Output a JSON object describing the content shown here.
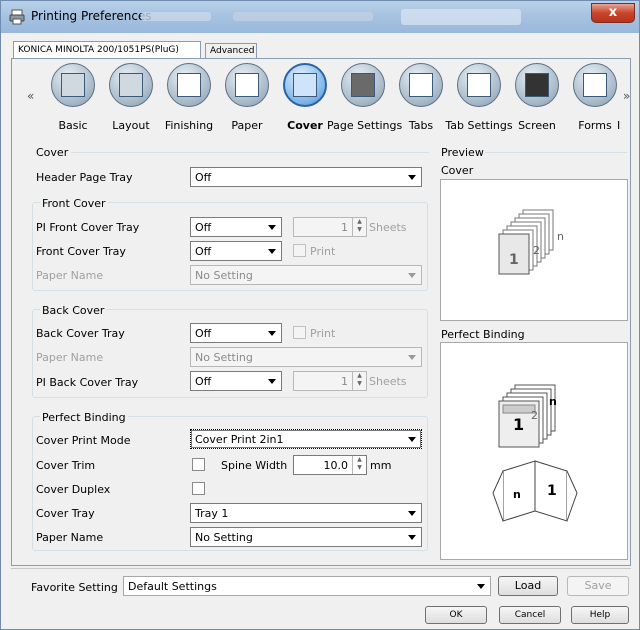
{
  "window": {
    "title": "Printing Preferences",
    "close_glyph": "x"
  },
  "tabs": [
    {
      "label": "KONICA MINOLTA 200/1051PS(PluG)"
    },
    {
      "label": "Advanced"
    }
  ],
  "toolbar": {
    "items": [
      {
        "label": "Basic",
        "icon": "basic-icon"
      },
      {
        "label": "Layout",
        "icon": "layout-icon"
      },
      {
        "label": "Finishing",
        "icon": "finishing-icon"
      },
      {
        "label": "Paper",
        "icon": "paper-icon"
      },
      {
        "label": "Cover",
        "icon": "cover-icon",
        "selected": true
      },
      {
        "label": "Page Settings",
        "icon": "page-settings-icon"
      },
      {
        "label": "Tabs",
        "icon": "tabs-icon"
      },
      {
        "label": "Tab Settings",
        "icon": "tab-settings-icon"
      },
      {
        "label": "Screen",
        "icon": "screen-icon"
      },
      {
        "label": "Forms",
        "icon": "forms-icon"
      }
    ],
    "left_arrow": "«",
    "right_arrow": "»",
    "overflow_marker": "I"
  },
  "cover_section": {
    "title": "Cover",
    "header_page_tray": {
      "label": "Header Page Tray",
      "value": "Off"
    }
  },
  "front_cover": {
    "title": "Front Cover",
    "pi_tray": {
      "label": "PI Front Cover Tray",
      "value": "Off",
      "sheets_value": "1",
      "sheets_unit": "Sheets"
    },
    "tray": {
      "label": "Front Cover Tray",
      "value": "Off",
      "print_label": "Print"
    },
    "paper_name": {
      "label": "Paper Name",
      "value": "No Setting"
    }
  },
  "back_cover": {
    "title": "Back Cover",
    "tray": {
      "label": "Back Cover Tray",
      "value": "Off",
      "print_label": "Print"
    },
    "paper_name": {
      "label": "Paper Name",
      "value": "No Setting"
    },
    "pi_tray": {
      "label": "PI Back Cover Tray",
      "value": "Off",
      "sheets_value": "1",
      "sheets_unit": "Sheets"
    }
  },
  "perfect_binding": {
    "title": "Perfect Binding",
    "print_mode": {
      "label": "Cover Print Mode",
      "value": "Cover Print 2in1"
    },
    "trim": {
      "label": "Cover Trim",
      "spine_label": "Spine Width",
      "spine_value": "10.0",
      "spine_unit": "mm"
    },
    "duplex": {
      "label": "Cover Duplex"
    },
    "tray": {
      "label": "Cover Tray",
      "value": "Tray 1"
    },
    "paper_name": {
      "label": "Paper Name",
      "value": "No Setting"
    }
  },
  "preview": {
    "title": "Preview",
    "cover_label": "Cover",
    "binding_label": "Perfect Binding",
    "page_numbers": [
      "1",
      "2",
      "n"
    ]
  },
  "favorite": {
    "label": "Favorite Setting",
    "value": "Default Settings",
    "load_label": "Load",
    "save_label": "Save"
  },
  "footer": {
    "ok_label": "OK",
    "cancel_label": "Cancel",
    "help_label": "Help"
  },
  "colors": {
    "title_bar": "#a6c2e0",
    "selected_tool": "#3d7fc0",
    "close_button": "#c7452b"
  }
}
